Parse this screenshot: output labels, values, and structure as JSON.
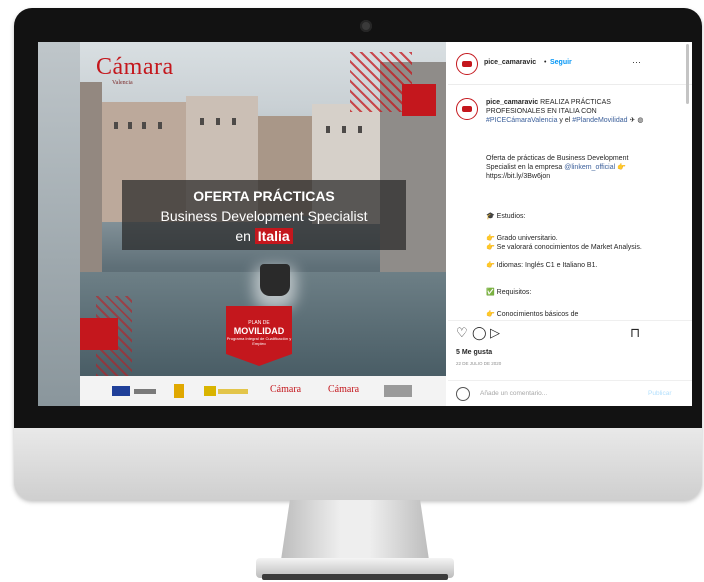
{
  "post": {
    "logo_text": "Cámara",
    "logo_subtext": "Valencia",
    "title_line1": "OFERTA PRÁCTICAS",
    "title_line2": "Business Development Specialist",
    "title_line3_prefix": "en ",
    "title_line3_highlight": "Italia",
    "badge_line1": "PLAN DE",
    "badge_line2": "MOVILIDAD",
    "badge_line3": "Programa Integral de Cualificación y Empleo",
    "footer_logo1": "Cámara",
    "footer_logo2": "Cámara"
  },
  "sidebar": {
    "username": "pice_camaravic",
    "follow_label": "Seguir",
    "more_label": "···",
    "caption_user": "pice_camaravic",
    "caption_line1": "REALIZA PRÁCTICAS PROFESIONALES EN ITALIA CON ",
    "caption_tag1": "#PICECámaraValencia",
    "caption_line2": " y el ",
    "caption_tag2": "#PlandeMovilidad",
    "offer_text": "Oferta de prácticas de Business Development Specialist en la empresa ",
    "offer_mention": "@linkem_official",
    "offer_link": "https://bit.ly/3Bw6jon",
    "studies_title": "🎓 Estudios:",
    "studies_item1": "👉 Grado universitario.",
    "studies_item2": "👉 Se valorará conocimientos de Market Analysis.",
    "studies_item3": "👉 Idiomas: Inglés C1 e Italiano B1.",
    "requirements_title": "✅ Requisitos:",
    "requirements_partial": "👉 Conocimientos básicos de",
    "likes": "5 Me gusta",
    "date": "22 DE JULIO DE 2020",
    "comment_placeholder": "Añade un comentario...",
    "publish_label": "Publicar"
  },
  "icons": {
    "heart": "heart-icon",
    "comment": "comment-icon",
    "share": "share-icon",
    "bookmark": "bookmark-icon",
    "emoji": "emoji-icon"
  },
  "colors": {
    "brand_red": "#c4171d",
    "link_blue": "#0095f6"
  }
}
